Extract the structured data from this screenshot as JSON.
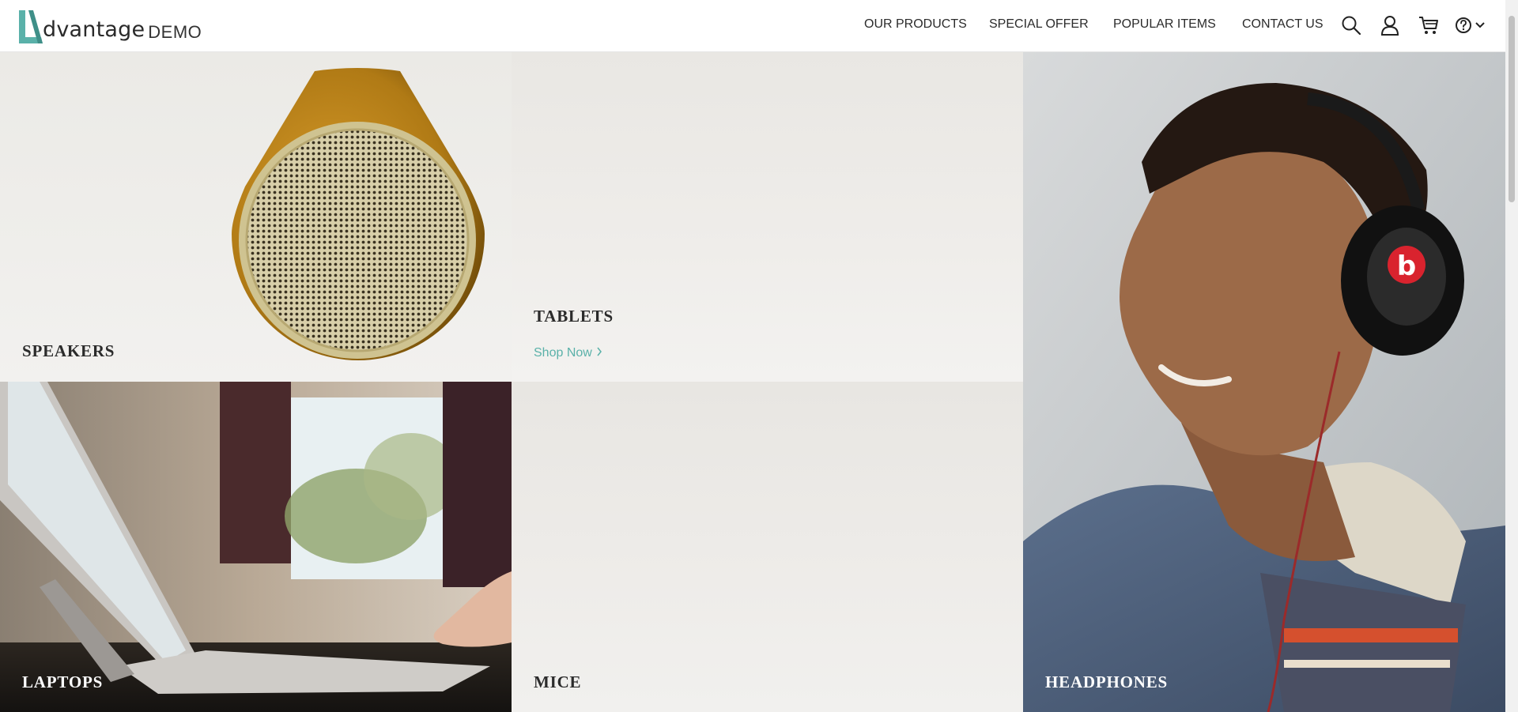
{
  "brand": {
    "name": "dvantage",
    "suffix": "DEMO",
    "accent_color": "#5ab1a9"
  },
  "nav": {
    "items": [
      {
        "label": "OUR PRODUCTS"
      },
      {
        "label": "SPECIAL OFFER"
      },
      {
        "label": "POPULAR ITEMS"
      },
      {
        "label": "CONTACT US"
      }
    ],
    "icons": [
      "search-icon",
      "user-icon",
      "cart-icon",
      "help-icon",
      "chevron-down-icon"
    ]
  },
  "categories": {
    "speakers": {
      "label": "SPEAKERS"
    },
    "tablets": {
      "label": "TABLETS",
      "cta": "Shop Now"
    },
    "laptops": {
      "label": "LAPTOPS"
    },
    "mice": {
      "label": "MICE"
    },
    "headphones": {
      "label": "HEADPHONES"
    }
  }
}
